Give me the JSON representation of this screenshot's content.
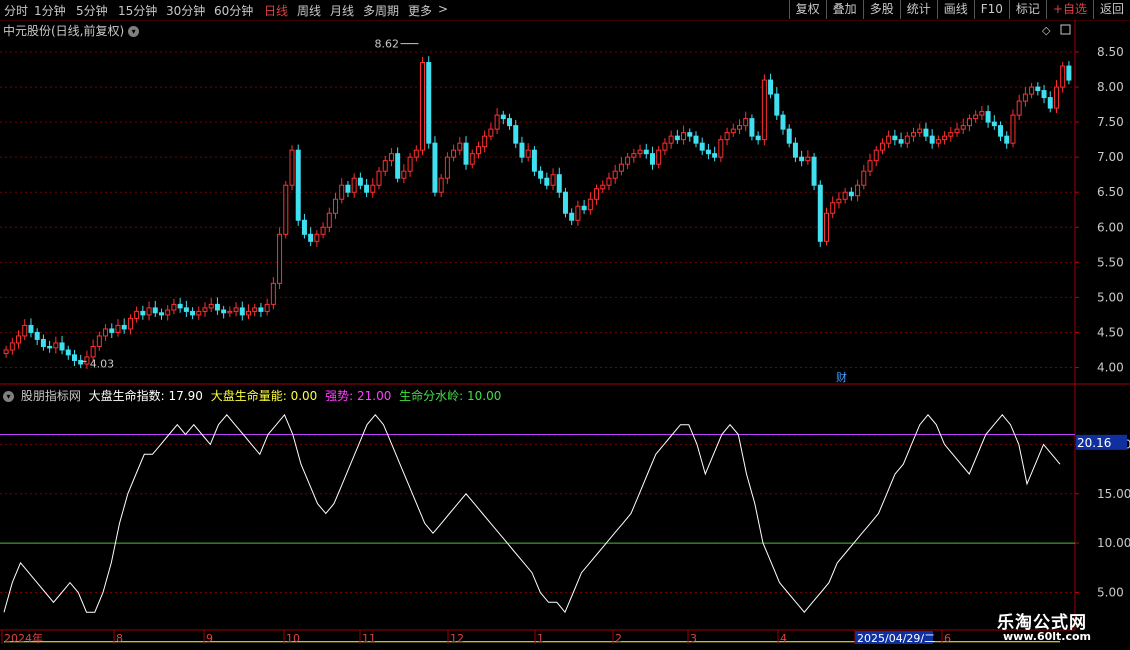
{
  "toolbar": {
    "periods": [
      {
        "label": "分时",
        "active": false
      },
      {
        "label": "1分钟",
        "active": false
      },
      {
        "label": "5分钟",
        "active": false
      },
      {
        "label": "15分钟",
        "active": false
      },
      {
        "label": "30分钟",
        "active": false
      },
      {
        "label": "60分钟",
        "active": false
      },
      {
        "label": "日线",
        "active": true
      },
      {
        "label": "周线",
        "active": false
      },
      {
        "label": "月线",
        "active": false
      },
      {
        "label": "多周期",
        "active": false
      },
      {
        "label": "更多",
        "active": false
      }
    ],
    "more_arrow": ">",
    "right_buttons": [
      {
        "label": "复权"
      },
      {
        "label": "叠加"
      },
      {
        "label": "多股"
      },
      {
        "label": "统计"
      },
      {
        "label": "画线"
      },
      {
        "label": "F10"
      },
      {
        "label": "标记"
      },
      {
        "label": "+自选"
      },
      {
        "label": "返回"
      }
    ]
  },
  "main_title": "中元股份(日线,前复权)",
  "indicator": {
    "name": "股朋指标网",
    "items": [
      {
        "label": "大盘生命指数: 17.90",
        "color": "#ffffff"
      },
      {
        "label": "大盘生命量能: 0.00",
        "color": "#ffff40"
      },
      {
        "label": "强势: 21.00",
        "color": "#ff40ff"
      },
      {
        "label": "生命分水岭: 10.00",
        "color": "#40e040"
      }
    ],
    "marker_value": "20.16"
  },
  "annotations": {
    "high": "8.62",
    "low": "4.03",
    "fin_marker": "财"
  },
  "watermark": {
    "line1": "乐淘公式网",
    "line2": "www.60lt.com"
  },
  "colors": {
    "up": "#ff3030",
    "down": "#40e0f0",
    "grid": "#7a0000",
    "white_line": "#ffffff",
    "yellow_line": "#ffff40",
    "magenta_line": "#c040ff",
    "green_line": "#40c040"
  },
  "chart_data": [
    {
      "type": "candlestick",
      "title": "中元股份(日线,前复权)",
      "ylim": [
        3.85,
        8.7
      ],
      "y_ticks": [
        "8.50",
        "8.00",
        "7.50",
        "7.00",
        "6.50",
        "6.00",
        "5.50",
        "5.00",
        "4.50",
        "4.00"
      ],
      "x_ticks": [
        "2024年",
        "8",
        "9",
        "10",
        "11",
        "12",
        "1",
        "2",
        "3",
        "4",
        "2025/04/29/二",
        "6"
      ],
      "closes": [
        4.25,
        4.35,
        4.45,
        4.6,
        4.5,
        4.4,
        4.3,
        4.28,
        4.35,
        4.25,
        4.18,
        4.1,
        4.05,
        4.15,
        4.3,
        4.45,
        4.55,
        4.5,
        4.6,
        4.55,
        4.7,
        4.8,
        4.75,
        4.85,
        4.78,
        4.75,
        4.82,
        4.9,
        4.85,
        4.8,
        4.75,
        4.8,
        4.85,
        4.9,
        4.82,
        4.78,
        4.8,
        4.85,
        4.75,
        4.8,
        4.85,
        4.8,
        4.9,
        5.2,
        5.9,
        6.6,
        7.1,
        6.1,
        5.9,
        5.8,
        5.9,
        6.0,
        6.2,
        6.4,
        6.6,
        6.5,
        6.7,
        6.6,
        6.5,
        6.6,
        6.8,
        6.95,
        7.05,
        6.7,
        6.8,
        7.0,
        7.1,
        8.35,
        7.2,
        6.5,
        6.7,
        7.0,
        7.1,
        7.2,
        6.9,
        7.05,
        7.15,
        7.3,
        7.4,
        7.6,
        7.55,
        7.45,
        7.2,
        7.0,
        7.1,
        6.8,
        6.7,
        6.6,
        6.75,
        6.5,
        6.2,
        6.1,
        6.3,
        6.25,
        6.4,
        6.55,
        6.6,
        6.7,
        6.8,
        6.9,
        7.0,
        7.05,
        7.1,
        7.05,
        6.9,
        7.1,
        7.2,
        7.3,
        7.25,
        7.35,
        7.3,
        7.2,
        7.1,
        7.05,
        7.0,
        7.25,
        7.35,
        7.4,
        7.45,
        7.55,
        7.3,
        7.25,
        8.1,
        7.9,
        7.6,
        7.4,
        7.2,
        7.0,
        6.95,
        7.0,
        6.6,
        5.8,
        6.2,
        6.35,
        6.4,
        6.5,
        6.45,
        6.6,
        6.8,
        6.95,
        7.1,
        7.2,
        7.3,
        7.25,
        7.2,
        7.3,
        7.35,
        7.4,
        7.3,
        7.2,
        7.25,
        7.3,
        7.35,
        7.4,
        7.45,
        7.55,
        7.6,
        7.65,
        7.5,
        7.45,
        7.3,
        7.2,
        7.6,
        7.8,
        7.9,
        8.0,
        7.95,
        7.85,
        7.7,
        8.0,
        8.3,
        8.1
      ]
    },
    {
      "type": "line",
      "title": "股朋指标网",
      "ylim": [
        1.5,
        24.5
      ],
      "y_ticks": [
        "20.00",
        "15.00",
        "10.00",
        "5.00"
      ],
      "series": [
        {
          "name": "大盘生命指数",
          "values": [
            3,
            6,
            8,
            7,
            6,
            5,
            4,
            5,
            6,
            5,
            3,
            3,
            5,
            8,
            12,
            15,
            17,
            19,
            19,
            20,
            21,
            22,
            21,
            22,
            21,
            20,
            22,
            23,
            22,
            21,
            20,
            19,
            21,
            22,
            23,
            21,
            18,
            16,
            14,
            13,
            14,
            16,
            18,
            20,
            22,
            23,
            22,
            20,
            18,
            16,
            14,
            12,
            11,
            12,
            13,
            14,
            15,
            14,
            13,
            12,
            11,
            10,
            9,
            8,
            7,
            5,
            4,
            4,
            3,
            5,
            7,
            8,
            9,
            10,
            11,
            12,
            13,
            15,
            17,
            19,
            20,
            21,
            22,
            22,
            20,
            17,
            19,
            21,
            22,
            21,
            17,
            14,
            10,
            8,
            6,
            5,
            4,
            3,
            4,
            5,
            6,
            8,
            9,
            10,
            11,
            12,
            13,
            15,
            17,
            18,
            20,
            22,
            23,
            22,
            20,
            19,
            18,
            17,
            19,
            21,
            22,
            23,
            22,
            20,
            16,
            18,
            20,
            19,
            18
          ]
        },
        {
          "name": "大盘生命量能",
          "values": [
            0,
            0,
            0,
            0,
            0,
            0,
            0,
            0,
            0,
            0,
            0,
            0,
            0,
            0,
            0,
            0,
            0,
            0,
            0,
            0,
            0,
            0,
            0,
            0,
            0,
            0,
            0,
            0,
            0,
            0,
            0,
            0,
            0,
            0,
            0,
            0,
            0,
            0,
            0,
            0,
            0,
            0,
            0,
            0,
            0,
            0,
            0,
            0,
            0,
            0,
            0,
            0,
            0,
            0,
            0,
            0,
            0,
            0,
            0,
            0,
            0,
            0,
            0,
            0,
            0,
            0,
            0,
            0,
            0,
            0,
            0,
            0,
            0,
            0,
            0,
            0,
            0,
            0,
            0,
            0,
            0,
            0,
            0,
            0,
            0,
            0,
            0,
            0,
            0,
            0,
            0,
            0,
            0,
            0,
            0,
            0,
            0,
            0,
            0,
            0,
            0,
            0,
            0,
            0,
            0,
            0,
            0,
            0,
            0,
            0,
            0,
            0,
            0,
            0,
            0,
            0,
            0,
            0,
            0,
            0,
            0,
            0,
            0,
            0,
            0,
            0,
            0,
            0,
            0
          ]
        },
        {
          "name": "强势",
          "values": [
            21
          ]
        },
        {
          "name": "生命分水岭",
          "values": [
            10
          ]
        }
      ]
    }
  ]
}
